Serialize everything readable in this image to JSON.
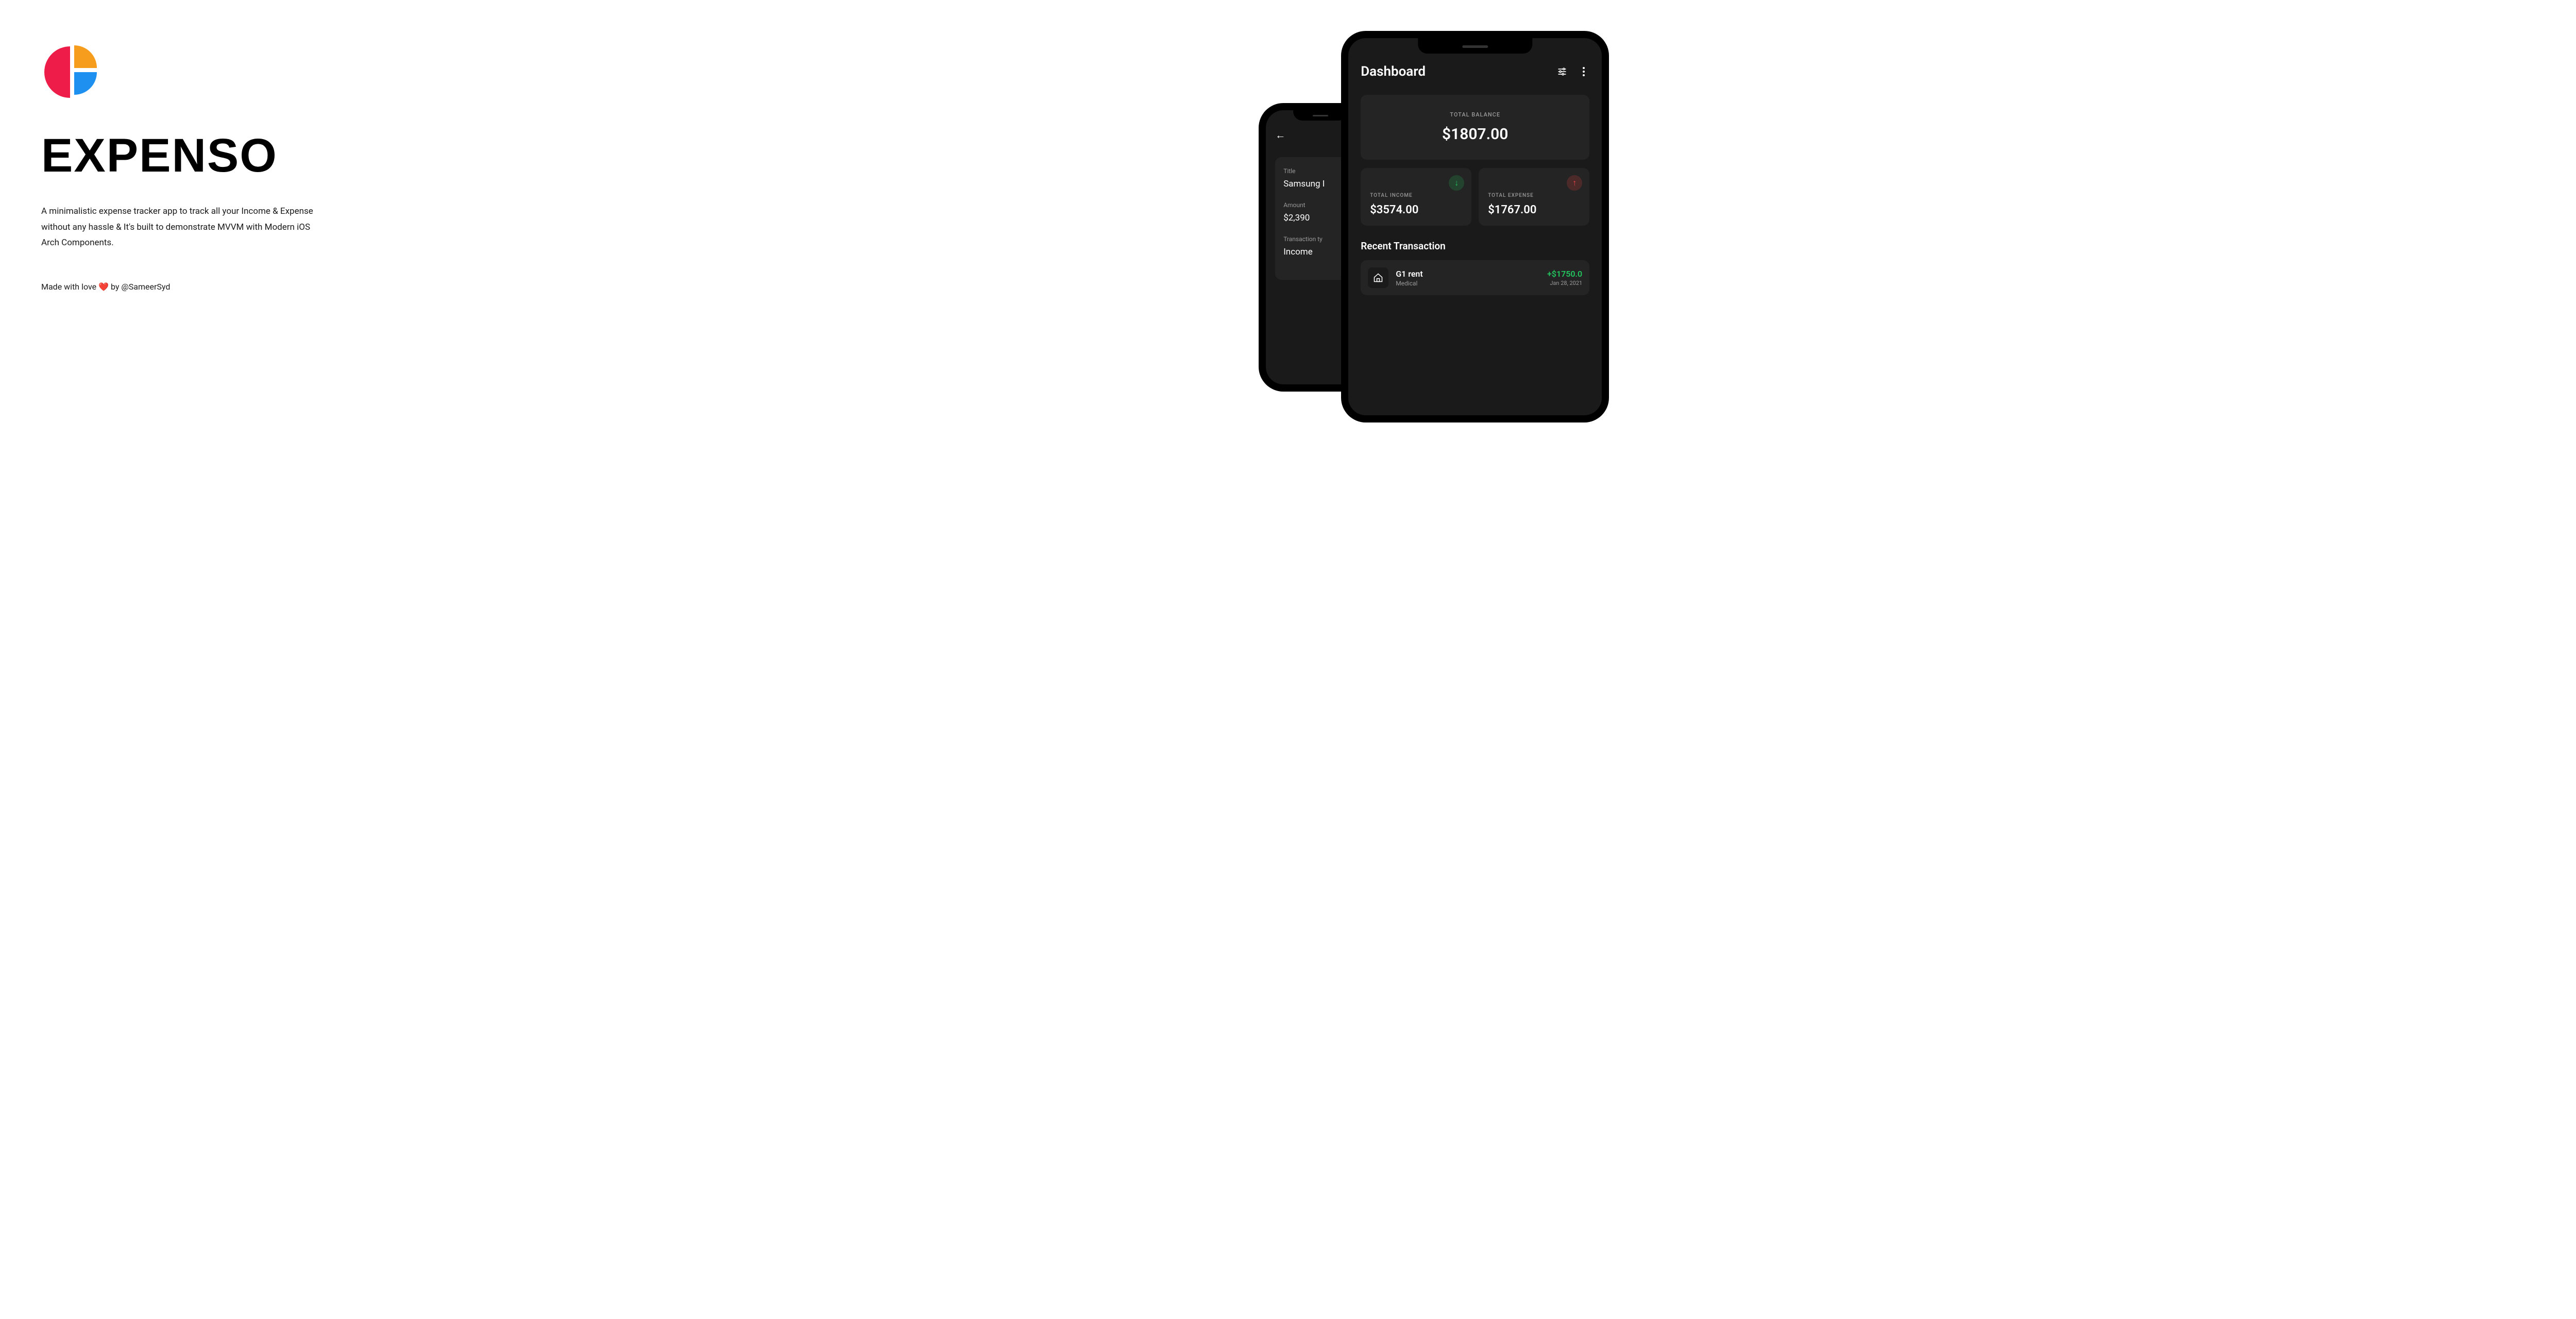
{
  "logo": {
    "colors": {
      "red": "#ED1C48",
      "orange": "#F79D1E",
      "blue": "#1E90F0"
    }
  },
  "title": "EXPENSO",
  "description": "A minimalistic expense tracker app to track all your Income & Expense without any hassle & It's built to demonstrate MVVM with Modern iOS Arch Components.",
  "credit_prefix": "Made with love ",
  "credit_heart": "❤️",
  "credit_suffix": " by @SameerSyd",
  "back_phone": {
    "fields": {
      "title_label": "Title",
      "title_value": "Samsung I",
      "amount_label": "Amount",
      "amount_value": "$2,390",
      "type_label": "Transaction ty",
      "type_value": "Income"
    }
  },
  "front_phone": {
    "header_title": "Dashboard",
    "balance_label": "TOTAL BALANCE",
    "balance_value": "$1807.00",
    "income_label": "TOTAL INCOME",
    "income_value": "$3574.00",
    "expense_label": "TOTAL EXPENSE",
    "expense_value": "$1767.00",
    "section_title": "Recent Transaction",
    "transaction": {
      "name": "G1 rent",
      "category": "Medical",
      "amount": "+$1750.0",
      "date": "Jan 28, 2021"
    }
  }
}
